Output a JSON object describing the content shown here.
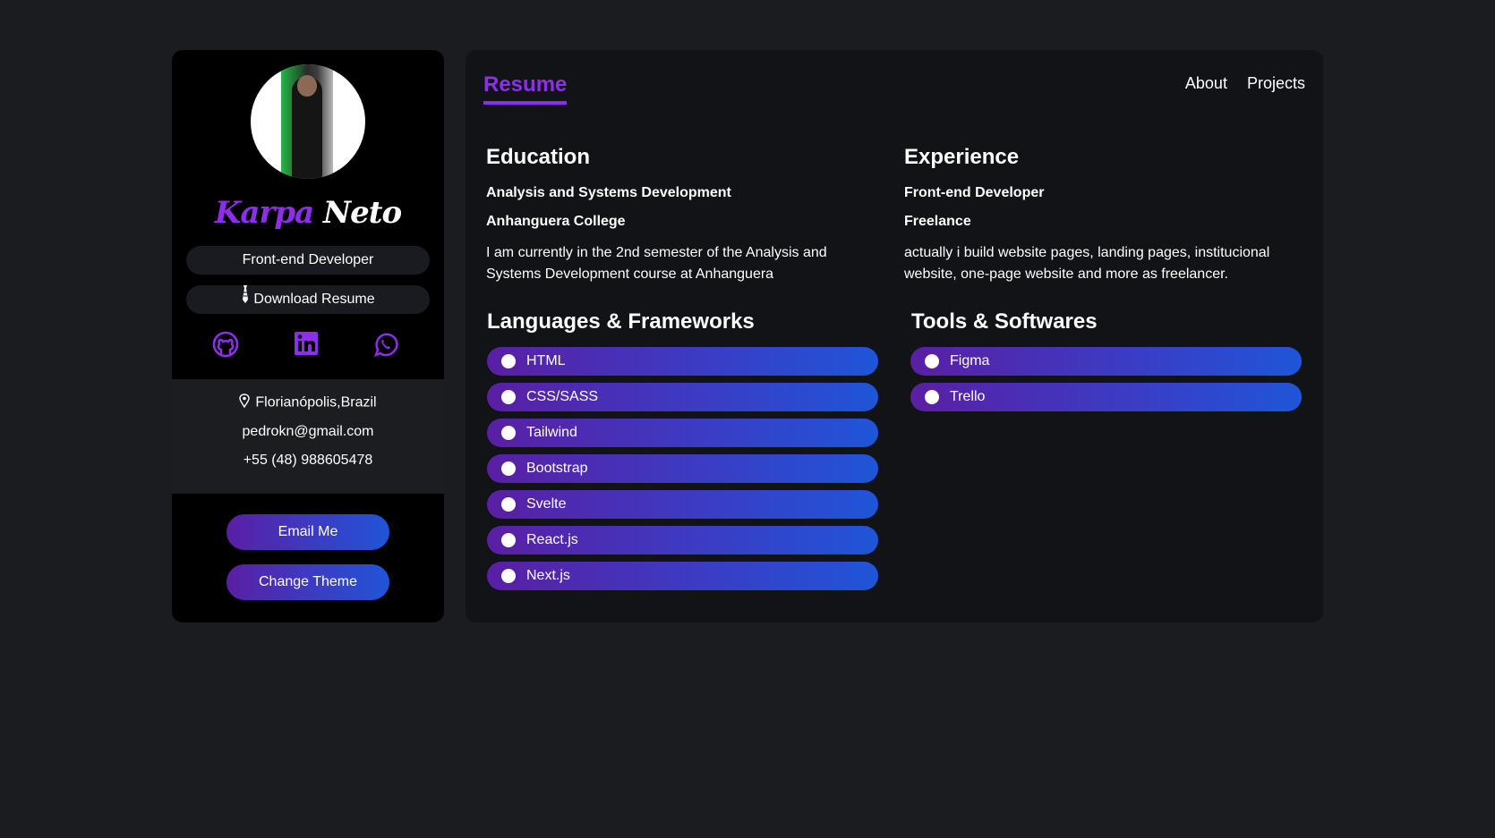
{
  "profile": {
    "first_name": "Karpa",
    "last_name": "Neto",
    "role": "Front-end Developer",
    "download_label": "Download Resume",
    "location": "Florianópolis,Brazil",
    "email": "pedrokn@gmail.com",
    "phone": "+55 (48) 988605478",
    "email_button": "Email Me",
    "theme_button": "Change Theme"
  },
  "nav": {
    "active_tab": "Resume",
    "links": [
      "About",
      "Projects"
    ]
  },
  "education": {
    "title": "Education",
    "course": "Analysis and Systems Development",
    "school": "Anhanguera College",
    "description": "I am currently in the 2nd semester of the Analysis and Systems Development course at Anhanguera"
  },
  "experience": {
    "title": "Experience",
    "role": "Front-end Developer",
    "company": "Freelance",
    "description": "actually i build website pages, landing pages, institucional website, one-page website and more as freelancer."
  },
  "languages": {
    "title": "Languages & Frameworks",
    "items": [
      "HTML",
      "CSS/SASS",
      "Tailwind",
      "Bootstrap",
      "Svelte",
      "React.js",
      "Next.js"
    ]
  },
  "tools": {
    "title": "Tools & Softwares",
    "items": [
      "Figma",
      "Trello"
    ]
  },
  "colors": {
    "accent": "#8e2ee8",
    "gradient_start": "#5a1fa3",
    "gradient_end": "#1f55d8"
  },
  "icons": [
    "tie-icon",
    "github-icon",
    "linkedin-icon",
    "whatsapp-icon",
    "location-pin-icon"
  ]
}
